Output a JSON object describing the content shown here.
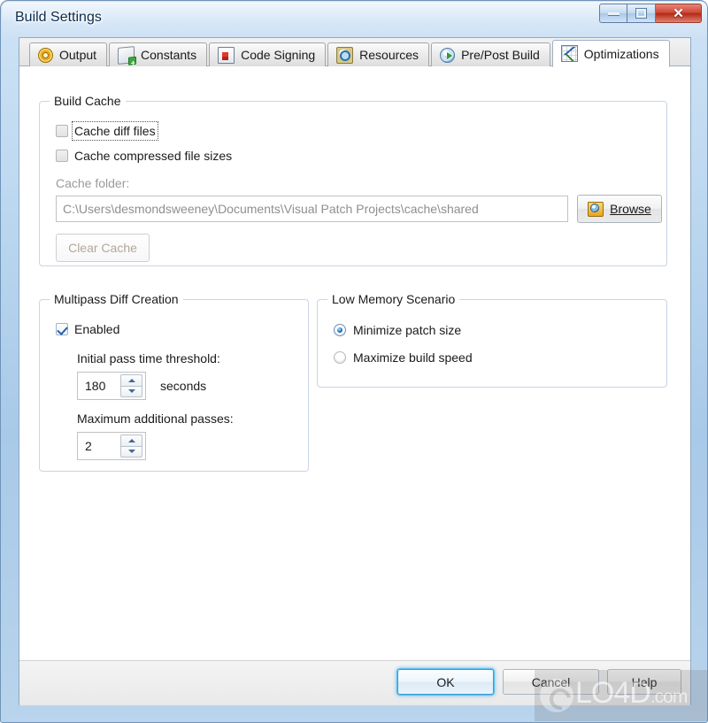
{
  "window": {
    "title": "Build Settings",
    "controls": {
      "minimize": "Minimize",
      "maximize": "Maximize",
      "close": "Close",
      "close_glyph": "✕"
    }
  },
  "tabs": [
    {
      "label": "Output",
      "icon": "disc-icon",
      "active": false
    },
    {
      "label": "Constants",
      "icon": "constants-icon",
      "active": false
    },
    {
      "label": "Code Signing",
      "icon": "certificate-icon",
      "active": false
    },
    {
      "label": "Resources",
      "icon": "magnifier-icon",
      "active": false
    },
    {
      "label": "Pre/Post Build",
      "icon": "clock-play-icon",
      "active": false
    },
    {
      "label": "Optimizations",
      "icon": "chart-icon",
      "active": true
    }
  ],
  "build_cache": {
    "title": "Build Cache",
    "cache_diff_files": {
      "label": "Cache diff files",
      "checked": false,
      "focused": true
    },
    "cache_compressed_file_sizes": {
      "label": "Cache compressed file sizes",
      "checked": false
    },
    "cache_folder_label": "Cache folder:",
    "cache_folder_value": "C:\\Users\\desmondsweeney\\Documents\\Visual Patch Projects\\cache\\shared",
    "browse_button": "Browse",
    "clear_cache_button": "Clear Cache"
  },
  "multipass": {
    "title": "Multipass Diff Creation",
    "enabled": {
      "label": "Enabled",
      "checked": true
    },
    "initial_pass_label": "Initial pass time threshold:",
    "initial_pass_value": "180",
    "seconds_label": "seconds",
    "max_passes_label": "Maximum additional passes:",
    "max_passes_value": "2"
  },
  "low_memory": {
    "title": "Low Memory Scenario",
    "options": [
      {
        "label": "Minimize patch size",
        "selected": true
      },
      {
        "label": "Maximize build speed",
        "selected": false
      }
    ]
  },
  "footer": {
    "ok": "OK",
    "cancel": "Cancel",
    "help": "Help"
  },
  "watermark": {
    "text": "LO4D",
    "suffix": ".com"
  }
}
